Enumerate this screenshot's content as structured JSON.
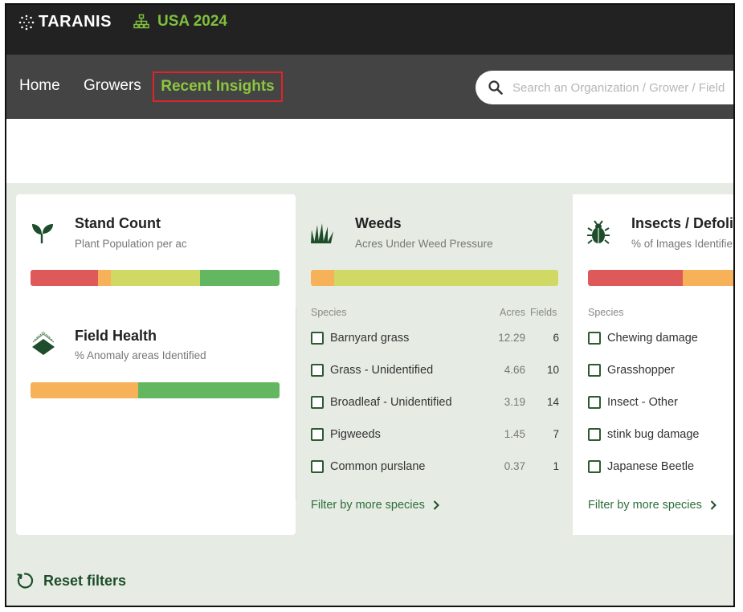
{
  "header": {
    "brand": "TARANIS",
    "season": "USA 2024"
  },
  "nav": {
    "home": "Home",
    "growers": "Growers",
    "recent_insights": "Recent Insights"
  },
  "search": {
    "placeholder": "Search an Organization / Grower / Field"
  },
  "cards": {
    "stand_count": {
      "title": "Stand Count",
      "subtitle": "Plant Population per ac"
    },
    "field_health": {
      "title": "Field Health",
      "subtitle": "% Anomaly areas Identified"
    },
    "weeds": {
      "title": "Weeds",
      "subtitle": "Acres Under Weed Pressure",
      "species_header": "Species",
      "acres_header": "Acres",
      "fields_header": "Fields",
      "species": [
        {
          "name": "Barnyard grass",
          "acres": "12.29",
          "fields": "6"
        },
        {
          "name": "Grass - Unidentified",
          "acres": "4.66",
          "fields": "10"
        },
        {
          "name": "Broadleaf - Unidentified",
          "acres": "3.19",
          "fields": "14"
        },
        {
          "name": "Pigweeds",
          "acres": "1.45",
          "fields": "7"
        },
        {
          "name": "Common purslane",
          "acres": "0.37",
          "fields": "1"
        }
      ],
      "filter_link": "Filter by more species"
    },
    "insects": {
      "title": "Insects / Defoli",
      "subtitle": "% of Images Identifie",
      "species_header": "Species",
      "species": [
        {
          "name": "Chewing damage"
        },
        {
          "name": "Grasshopper"
        },
        {
          "name": "Insect - Other"
        },
        {
          "name": "stink bug damage"
        },
        {
          "name": "Japanese Beetle"
        }
      ],
      "filter_link": "Filter by more species"
    }
  },
  "reset": "Reset filters",
  "colors": {
    "red": "#de5a5a",
    "orange": "#f7b259",
    "yellow_green": "#cfd964",
    "green": "#63b760",
    "accent": "#8cc63f",
    "dark_green": "#1e4d2b"
  },
  "icons": {
    "search": "search-icon",
    "season": "org-tree-icon",
    "sprout": "sprout-icon",
    "field_health": "field-health-icon",
    "weeds": "grass-icon",
    "insect": "beetle-icon",
    "reset": "reset-icon",
    "chevron": "chevron-right-icon"
  }
}
